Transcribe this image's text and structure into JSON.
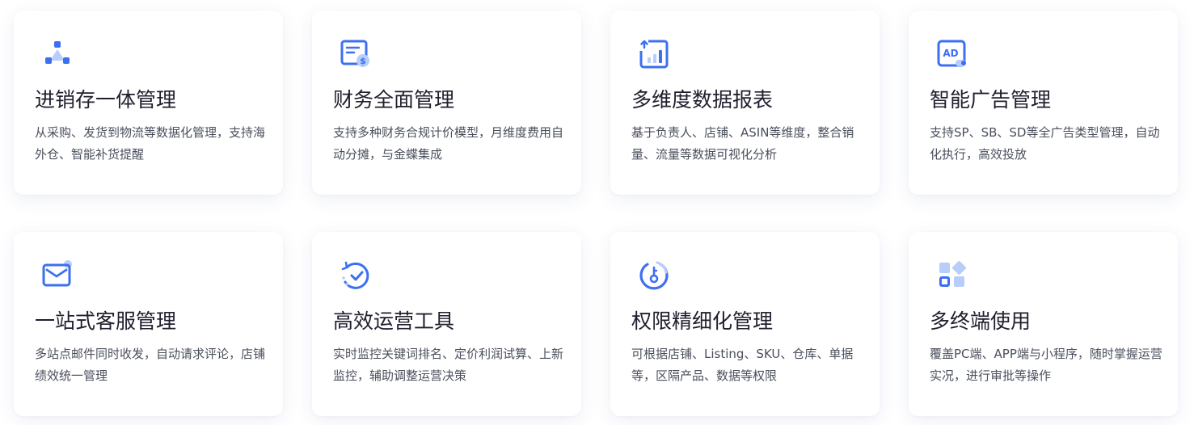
{
  "colors": {
    "accent": "#3d6ff0",
    "accent_light": "#b9cdfb",
    "title": "#1f1f2e",
    "text": "#4a4f5c"
  },
  "cards": [
    {
      "icon": "network-nodes-icon",
      "title": "进销存一体管理",
      "desc": "从采购、发货到物流等数据化管理，支持海外仓、智能补货提醒"
    },
    {
      "icon": "invoice-dollar-icon",
      "title": "财务全面管理",
      "desc": "支持多种财务合规计价模型，月维度费用自动分摊，与金蝶集成"
    },
    {
      "icon": "bar-chart-report-icon",
      "title": "多维度数据报表",
      "desc": "基于负责人、店铺、ASIN等维度，整合销量、流量等数据可视化分析"
    },
    {
      "icon": "ad-icon",
      "title": "智能广告管理",
      "desc": "支持SP、SB、SD等全广告类型管理，自动化执行，高效投放"
    },
    {
      "icon": "mail-icon",
      "title": "一站式客服管理",
      "desc": "多站点邮件同时收发，自动请求评论，店铺绩效统一管理"
    },
    {
      "icon": "refresh-check-icon",
      "title": "高效运营工具",
      "desc": "实时监控关键词排名、定价利润试算、上新监控，辅助调整运营决策"
    },
    {
      "icon": "key-permission-icon",
      "title": "权限精细化管理",
      "desc": "可根据店铺、Listing、SKU、仓库、单据等，区隔产品、数据等权限"
    },
    {
      "icon": "multi-terminal-icon",
      "title": "多终端使用",
      "desc": "覆盖PC端、APP端与小程序，随时掌握运营实况，进行审批等操作"
    }
  ]
}
